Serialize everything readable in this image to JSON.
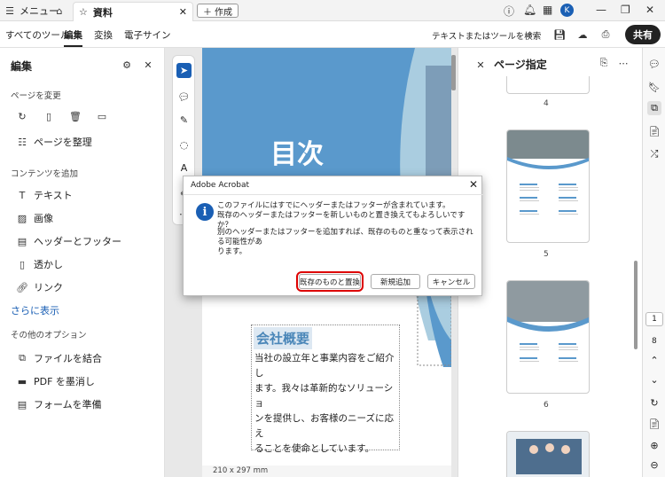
{
  "titlebar": {
    "menu_label": "メニュー",
    "tab_title": "資料",
    "new_tab_label": "作成",
    "avatar_letter": "K"
  },
  "toolbar": {
    "tabs": [
      "すべてのツール",
      "編集",
      "変換",
      "電子サイン"
    ],
    "search_label": "テキストまたはツールを検索",
    "share_label": "共有"
  },
  "leftpanel": {
    "title": "編集",
    "sec_pages": "ページを変更",
    "organize_label": "ページを整理",
    "sec_content": "コンテンツを追加",
    "items": [
      "テキスト",
      "画像",
      "ヘッダーとフッター",
      "透かし",
      "リンク"
    ],
    "more_label": "さらに表示",
    "sec_other": "その他のオプション",
    "other_items": [
      "ファイルを結合",
      "PDF を墨消し",
      "フォームを準備"
    ]
  },
  "document": {
    "heading": "目次",
    "section_title": "会社概要",
    "body_text": [
      "当社の設立年と事業内容をご紹介し",
      "ます。我々は革新的なソリューショ",
      "ンを提供し、お客様のニーズに応え",
      "ることを使命としています。"
    ],
    "page_size": "210 x 297 mm"
  },
  "rightpane": {
    "title": "ページ指定",
    "page_numbers": [
      "4",
      "5",
      "6"
    ]
  },
  "farright": {
    "page_current": "1",
    "page_total": "8"
  },
  "dialog": {
    "title": "Adobe Acrobat",
    "message1_line1": "このファイルにはすでにヘッダーまたはフッターが含まれています。",
    "message1_line2": "既存のヘッダーまたはフッターを新しいものと置き換えてもよろしいですか？",
    "message2_line1": "別のヘッダーまたはフッターを追加すれば、既存のものと重なって表示される可能性があ",
    "message2_line2": "ります。",
    "btn_replace": "既存のものと置換",
    "btn_add": "新規追加",
    "btn_cancel": "キャンセル"
  },
  "colors": {
    "accent": "#1a5fb4",
    "highlight": "#d00000",
    "band": "#5a99cc"
  }
}
